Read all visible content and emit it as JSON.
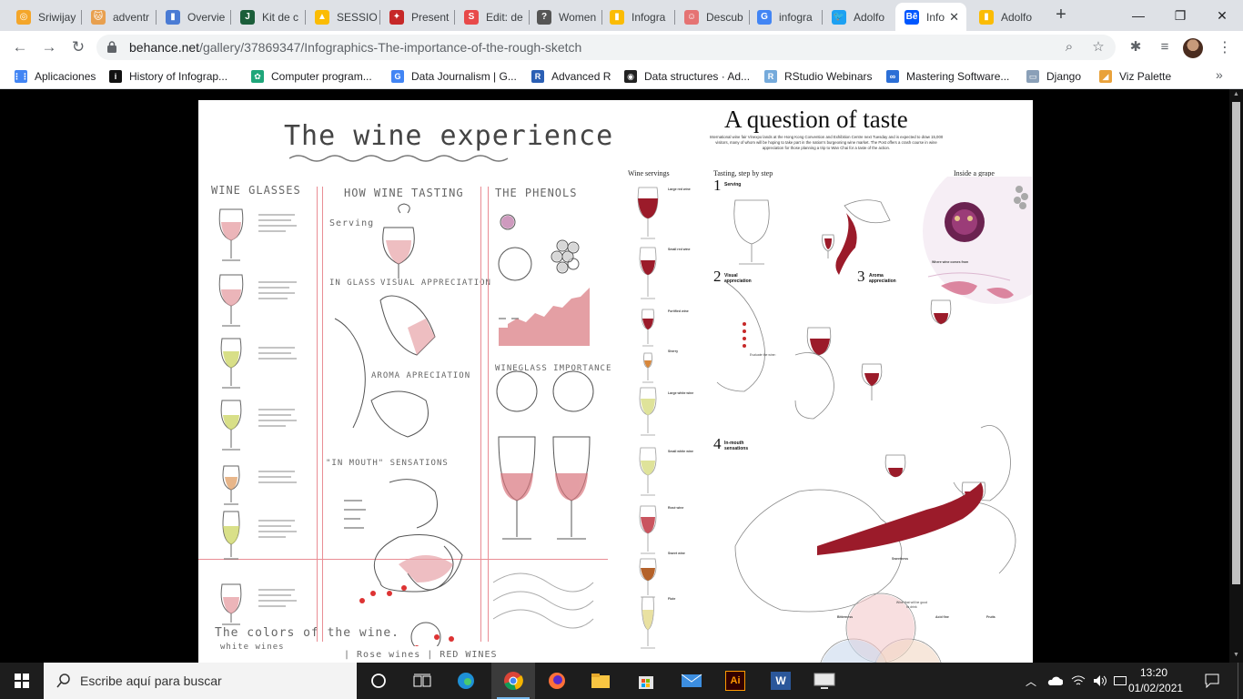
{
  "tabs": [
    {
      "label": "Sriwijay",
      "color": "#f4a62a",
      "glyph": "◎"
    },
    {
      "label": "adventr",
      "color": "#e8a04f",
      "glyph": "🐱"
    },
    {
      "label": "Overvie",
      "color": "#4a7bd4",
      "glyph": "▮"
    },
    {
      "label": "Kit de c",
      "color": "#1b5e3a",
      "glyph": "J"
    },
    {
      "label": "SESSIO",
      "color": "#fbbc04",
      "glyph": "▲"
    },
    {
      "label": "Present",
      "color": "#c62828",
      "glyph": "✦"
    },
    {
      "label": "Edit: de",
      "color": "#e84a4a",
      "glyph": "S"
    },
    {
      "label": "Women",
      "color": "#555555",
      "glyph": "?"
    },
    {
      "label": "Infogra",
      "color": "#fbbc04",
      "glyph": "▮"
    },
    {
      "label": "Descub",
      "color": "#e57373",
      "glyph": "☺"
    },
    {
      "label": "infogra",
      "color": "#4285f4",
      "glyph": "G"
    },
    {
      "label": "Adolfo",
      "color": "#1da1f2",
      "glyph": "🐦"
    },
    {
      "label": "Info",
      "color": "#0057ff",
      "glyph": "Bē"
    },
    {
      "label": "Adolfo",
      "color": "#fbbc04",
      "glyph": "▮"
    }
  ],
  "browser": {
    "url_host": "behance.net",
    "url_path": "/gallery/37869347/Infographics-The-importance-of-the-rough-sketch"
  },
  "bookmarks": [
    {
      "label": "Aplicaciones",
      "color": "#4285f4",
      "glyph": "⋮⋮"
    },
    {
      "label": "History of Infograp...",
      "color": "#111111",
      "glyph": "i"
    },
    {
      "label": "Computer program...",
      "color": "#1fa67a",
      "glyph": "✿"
    },
    {
      "label": "Data Journalism | G...",
      "color": "#4285f4",
      "glyph": "G"
    },
    {
      "label": "Advanced R",
      "color": "#2b5fb4",
      "glyph": "R"
    },
    {
      "label": "Data structures · Ad...",
      "color": "#222222",
      "glyph": "◉"
    },
    {
      "label": "RStudio Webinars",
      "color": "#75aadb",
      "glyph": "R"
    },
    {
      "label": "Mastering Software...",
      "color": "#2c6fd6",
      "glyph": "∞"
    },
    {
      "label": "Django",
      "color": "#8aa0b8",
      "glyph": "▭"
    },
    {
      "label": "Viz Palette",
      "color": "#e9a23b",
      "glyph": "◢"
    }
  ],
  "sketch": {
    "title": "The wine experience",
    "col1": "WINE GLASSES",
    "col2": "HOW WINE TASTING",
    "col3": "THE PHENOLS",
    "in_glass": "IN GLASS",
    "visual": "VISUAL APPRECIATION",
    "aroma": "AROMA APRECIATION",
    "mouth": "\"IN MOUTH\" SENSATIONS",
    "importance": "WINEGLASS IMPORTANCE",
    "colors": "The colors of the wine.",
    "white": "white wines",
    "rose_red": "| Rose wines | RED WINES",
    "serving": "Serving"
  },
  "info": {
    "title": "A question of taste",
    "intro": "International wine fair Vinexpo lands at the Hong Kong Convention and Exhibition Centre next Tuesday and is expected to draw 15,000 visitors, many of whom will be hoping to take part in the nation's burgeoning wine market. The Post offers a crash course in wine appreciation for those planning a trip to Wan Chai for a taste of the action.",
    "wine_servings": "Wine servings",
    "tasting": "Tasting, step by step",
    "grape": "Inside a grape",
    "where": "Where wine comes from",
    "s1": "Serving",
    "s2": "Visual appreciation",
    "s3": "Aroma appreciation",
    "s4": "In-mouth sensations",
    "servings": [
      "Large red wine",
      "Small red wine",
      "Fortified wine",
      "Sherry",
      "Large white wine",
      "Small white wine",
      "Rosé wine",
      "Sweet wine",
      "Flute"
    ],
    "evaluate": "Evaluate the wine:",
    "sweetness": "Sweetness",
    "bitterness": "Bitterness",
    "acid": "Acid fine",
    "fruits": "Fruits",
    "center": "Wine that will be good to drink"
  },
  "taskbar": {
    "search_placeholder": "Escribe aquí para buscar",
    "time": "13:20",
    "date": "01/02/2021"
  }
}
